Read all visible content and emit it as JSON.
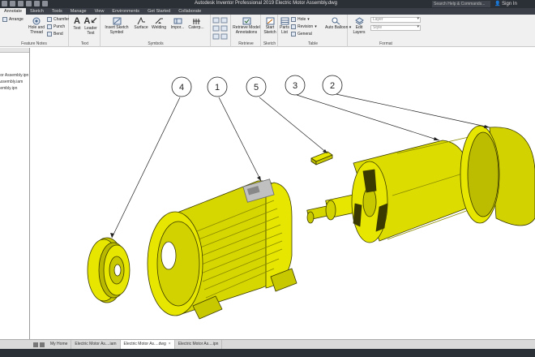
{
  "app": {
    "title": "Autodesk Inventor Professional 2019    Electric Motor Assembly.dwg",
    "search_placeholder": "Search Help & Commands...",
    "sign_in": "Sign In"
  },
  "tabs": [
    {
      "label": "Annotate",
      "active": true
    },
    {
      "label": "Sketch"
    },
    {
      "label": "Tools"
    },
    {
      "label": "Manage"
    },
    {
      "label": "View"
    },
    {
      "label": "Environments"
    },
    {
      "label": "Get Started"
    },
    {
      "label": "Collaborate"
    }
  ],
  "ribbon": {
    "feature_notes": {
      "label": "Feature Notes",
      "arrange": "Arrange",
      "hole_thread": "Hole and Thread",
      "chamfer": "Chamfer",
      "punch": "Punch",
      "bend": "Bend"
    },
    "text": {
      "label": "Text",
      "text": "Text",
      "leader_text": "Leader Text"
    },
    "symbols": {
      "label": "Symbols",
      "insert_sketch_symbol": "Insert Sketch Symbol",
      "surface": "Surface",
      "welding": "Welding",
      "import": "Impor...",
      "caterpillar": "Caterp..."
    },
    "retrieve": {
      "label": "Retrieve",
      "retrieve_model_annotations": "Retrieve Model Annotations"
    },
    "sketch": {
      "label": "Sketch",
      "start_sketch": "Start Sketch"
    },
    "table": {
      "label": "Table",
      "parts_list": "Parts List",
      "hole": "Hole",
      "revision": "Revision",
      "general": "General",
      "auto_balloon": "Auto Balloon"
    },
    "format": {
      "label": "Format",
      "edit_layers": "Edit Layers",
      "layer_placeholder": "Layer",
      "style_placeholder": "Style"
    }
  },
  "browser": {
    "items": [
      "",
      "Motor Assembly.ipn",
      "or Assembly.iam",
      "Assembly.ipn"
    ]
  },
  "drawing": {
    "balloons": [
      {
        "number": "4",
        "part": "pulley"
      },
      {
        "number": "1",
        "part": "motor housing"
      },
      {
        "number": "5",
        "part": "key"
      },
      {
        "number": "3",
        "part": "rotor"
      },
      {
        "number": "2",
        "part": "end cap"
      }
    ],
    "part_color": "#e6e600",
    "outline_color": "#3a3a00"
  },
  "doc_tabs": [
    {
      "label": "My Home"
    },
    {
      "label": "Electric Motor As....iam"
    },
    {
      "label": "Electric Motor As....dwg",
      "active": true
    },
    {
      "label": "Electric Motor As....ipn"
    }
  ]
}
